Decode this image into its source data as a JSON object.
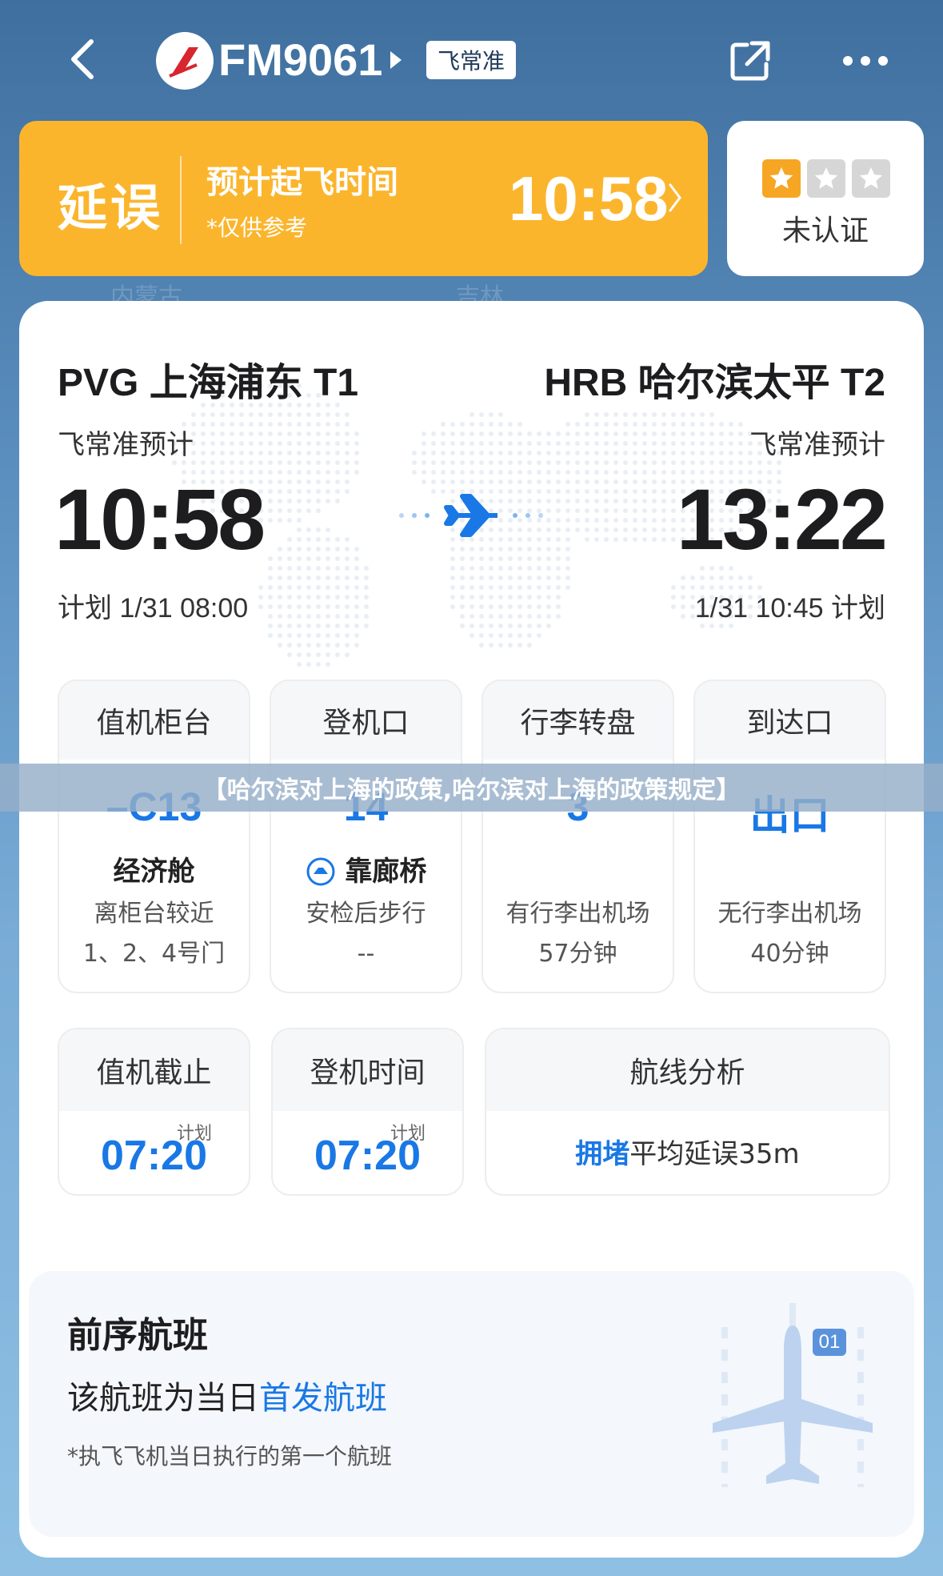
{
  "header": {
    "flight_number": "FM9061",
    "source_badge": "飞常准"
  },
  "status": {
    "state": "延误",
    "title": "预计起飞时间",
    "note": "*仅供参考",
    "time": "10:58"
  },
  "certification": {
    "label": "未认证",
    "stars_filled": 1,
    "stars_total": 3
  },
  "background_labels": [
    "内蒙古",
    "吉林"
  ],
  "route": {
    "departure": {
      "airport": "PVG 上海浦东 T1",
      "source": "飞常准预计",
      "time": "10:58",
      "plan": "计划 1/31 08:00"
    },
    "arrival": {
      "airport": "HRB 哈尔滨太平 T2",
      "source": "飞常准预计",
      "time": "13:22",
      "plan": "1/31 10:45 计划"
    }
  },
  "info_boxes": [
    {
      "title": "值机柜台",
      "value": "–C13",
      "sub": "经济舱",
      "desc1": "离柜台较近",
      "desc2": "1、2、4号门"
    },
    {
      "title": "登机口",
      "value": "14",
      "sub": "靠廊桥",
      "desc1": "安检后步行",
      "desc2": "--"
    },
    {
      "title": "行李转盘",
      "value": "3",
      "sub": "",
      "desc1": "有行李出机场",
      "desc2": "57分钟"
    },
    {
      "title": "到达口",
      "value": "出口",
      "sub": "",
      "desc1": "无行李出机场",
      "desc2": "40分钟"
    }
  ],
  "banner_text": "【哈尔滨对上海的政策,哈尔滨对上海的政策规定】",
  "times": [
    {
      "title": "值机截止",
      "tag": "计划",
      "value": "07:20"
    },
    {
      "title": "登机时间",
      "tag": "计划",
      "value": "07:20"
    }
  ],
  "route_analysis": {
    "title": "航线分析",
    "highlight": "拥堵",
    "text": "平均延误35m"
  },
  "previous_flight": {
    "title": "前序航班",
    "line_prefix": "该航班为当日",
    "line_highlight": "首发航班",
    "note": "*执飞飞机当日执行的第一个航班",
    "badge": "01"
  },
  "colors": {
    "delay_orange": "#fbb52d",
    "accent_blue": "#1978e5"
  }
}
